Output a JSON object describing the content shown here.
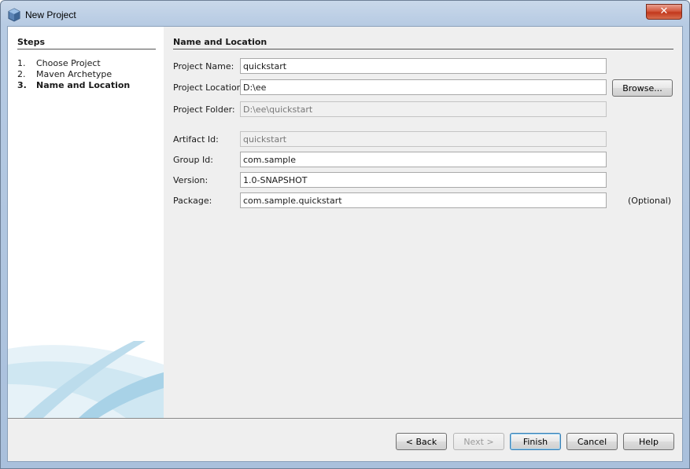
{
  "window": {
    "title": "New Project",
    "close_label": "✕"
  },
  "steps": {
    "title": "Steps",
    "items": [
      {
        "number": "1.",
        "label": "Choose Project"
      },
      {
        "number": "2.",
        "label": "Maven Archetype"
      },
      {
        "number": "3.",
        "label": "Name and Location"
      }
    ],
    "current_index": 2
  },
  "form": {
    "title": "Name and Location",
    "project_name": {
      "label": "Project Name:",
      "value": "quickstart"
    },
    "project_location": {
      "label": "Project Location:",
      "value": "D:\\ee"
    },
    "browse_label": "Browse...",
    "project_folder": {
      "label": "Project Folder:",
      "value": "D:\\ee\\quickstart"
    },
    "artifact_id": {
      "label": "Artifact Id:",
      "value": "quickstart"
    },
    "group_id": {
      "label": "Group Id:",
      "value": "com.sample"
    },
    "version": {
      "label": "Version:",
      "value": "1.0-SNAPSHOT"
    },
    "package": {
      "label": "Package:",
      "value": "com.sample.quickstart"
    },
    "optional_label": "(Optional)"
  },
  "buttons": {
    "back": "< Back",
    "next": "Next >",
    "finish": "Finish",
    "cancel": "Cancel",
    "help": "Help"
  },
  "colors": {
    "title_bar": "#b7cbe3",
    "close_button": "#c2381c",
    "panel_background": "#efefef",
    "default_button_border": "#3c7fb1"
  },
  "icons": {
    "app": "netbeans-cube-icon",
    "close": "close-icon"
  }
}
